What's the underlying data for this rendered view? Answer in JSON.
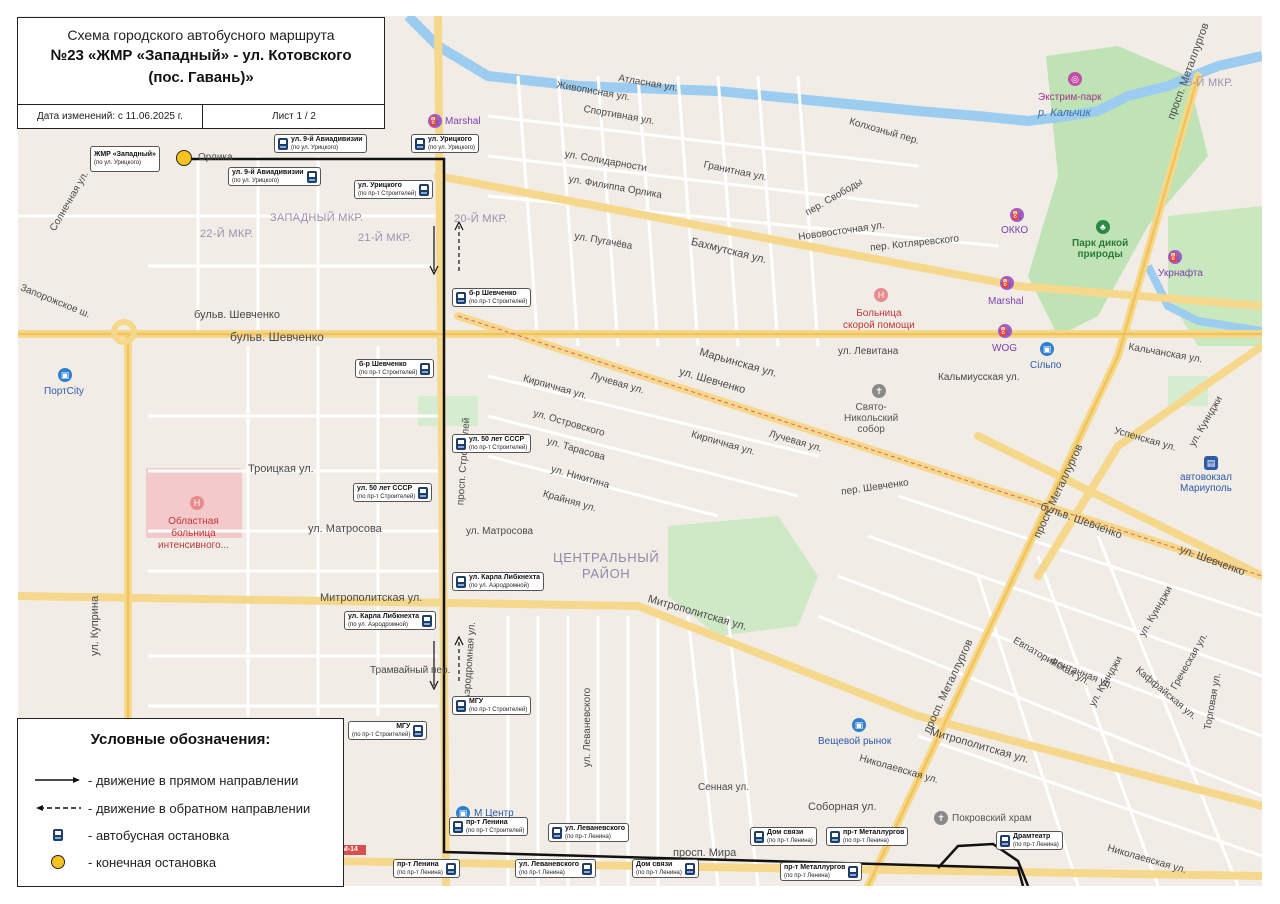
{
  "title": {
    "line1": "Схема городского автобусного маршрута",
    "line2": "№23 «ЖМР «Западный» - ул. Котовского",
    "line3": "(пос. Гавань)»",
    "date": "Дата изменений: с 11.06.2025 г.",
    "sheet": "Лист 1 / 2"
  },
  "legend": {
    "heading": "Условные обозначения:",
    "forward": "- движение в прямом направлении",
    "reverse": "- движение в обратном направлении",
    "bus_stop": "- автобусная остановка",
    "terminal": "- конечная остановка"
  },
  "terminal_stop": {
    "name": "ЖМР «Западный»",
    "sub": "(по ул. Урицкого)"
  },
  "stops": [
    {
      "name": "ул. 9-й Авиадивизии",
      "sub": "(по ул. Урицкого)"
    },
    {
      "name": "ул. Урицкого",
      "sub": "(по ул. Урицкого)"
    },
    {
      "name": "ул. 9-й Авиадивизии",
      "sub": "(по ул. Урицкого)"
    },
    {
      "name": "ул. Урицкого",
      "sub": "(по пр-т Строителей)"
    },
    {
      "name": "б-р Шевченко",
      "sub": "(по пр-т Строителей)"
    },
    {
      "name": "б-р Шевченко",
      "sub": "(по пр-т Строителей)"
    },
    {
      "name": "ул. 50 лет СССР",
      "sub": "(по пр-т Строителей)"
    },
    {
      "name": "ул. 50 лет СССР",
      "sub": "(по пр-т Строителей)"
    },
    {
      "name": "ул. Карла Либкнехта",
      "sub": "(по ул. Аэродромной)"
    },
    {
      "name": "ул. Карла Либкнехта",
      "sub": "(по ул. Аэродромной)"
    },
    {
      "name": "МГУ",
      "sub": "(по пр-т Строителей)"
    },
    {
      "name": "МГУ",
      "sub": "(по пр-т Строителей)"
    },
    {
      "name": "пр-т Ленина",
      "sub": "(по пр-т Строителей)"
    },
    {
      "name": "ул. Леваневского",
      "sub": "(по пр-т Ленина)"
    },
    {
      "name": "пр-т Ленина",
      "sub": "(по пр-т Ленина)"
    },
    {
      "name": "ул. Леваневского",
      "sub": "(по пр-т Ленина)"
    },
    {
      "name": "Дом связи",
      "sub": "(по пр-т Ленина)"
    },
    {
      "name": "Дом связи",
      "sub": "(по пр-т Ленина)"
    },
    {
      "name": "пр-т Металлургов",
      "sub": "(по пр-т Ленина)"
    },
    {
      "name": "пр-т Металлургов",
      "sub": "(по пр-т Ленина)"
    },
    {
      "name": "Драмтеатр",
      "sub": "(по пр-т Ленина)"
    }
  ],
  "districts": {
    "zapadny": "ЗАПАДНЫЙ МКР.",
    "mkr22": "22-Й МКР.",
    "mkr21": "21-Й МКР.",
    "mkr20": "20-Й МКР.",
    "mkr5": "5-Й МКР.",
    "central1": "ЦЕНТРАЛЬНЫЙ",
    "central2": "РАЙОН"
  },
  "streets": {
    "shevchenko_blvd": "бульв. Шевченко",
    "shevchenko_blvd2": "бульв. Шевченко",
    "shevchenko_blvd3": "бульв. Шевченко",
    "shevchenko_st": "ул. Шевченко",
    "shevchenko_st2": "ул. Шевченко",
    "kuprina": "ул. Куприна",
    "troitskaya": "Троицкая ул.",
    "matrosova": "ул. Матросова",
    "matrosova2": "ул. Матросова",
    "mitropolitskaya": "Митрополитская ул.",
    "mitropolitskaya2": "Митрополитская ул.",
    "mitropolitskaya3": "Митрополитская ул.",
    "tramvayny": "Трамвайный пер.",
    "marinskaya": "Марьинская ул.",
    "bakhmutskaya": "Бахмутская ул.",
    "metallurgov": "просп. Металлургов",
    "metallurgov2": "просп. Металлургов",
    "metallurgov3": "просп. Металлургов",
    "mira": "просп. Мира",
    "sobornaya": "Соборная ул.",
    "uspenskaya": "Успенская ул.",
    "nikolaevskaya": "Николаевская ул.",
    "nikolaevskaya2": "Николаевская ул.",
    "kalmiusskaya": "Кальмиусская ул.",
    "levitana": "ул. Левитана",
    "kotlyarevskogo": "пер. Котляревского",
    "svobody": "пер. Свободы",
    "novovostochnaya": "Нововосточная ул.",
    "kolkhozny": "Колхозный пер.",
    "atlasnaya": "Атласная ул.",
    "zhivopisnaya": "Живописная ул.",
    "sportivnaya": "Спортивная ул.",
    "solidarnosti": "ул. Солидарности",
    "orlika": "ул. Филиппа Орлика",
    "pugacheva": "ул. Пугачёва",
    "granitnaya": "Гранитная ул.",
    "luchevaya": "Лучевая ул.",
    "luchevaya2": "Лучевая ул.",
    "kirpichnaya": "Кирпичная ул.",
    "kirpichnaya2": "Кирпичная ул.",
    "ostrovskogo": "ул. Островского",
    "tarasova": "ул. Тарасова",
    "nikitina": "ул. Никитина",
    "krainyaya": "Крайняя ул.",
    "v_shevchenko": "пер. Шевченко",
    "gotfeiskaya": "Готфейская ул.",
    "evpatoriyskaya": "Евпаторийская ул.",
    "fontannaya": "Фонтанная ул.",
    "kaffaiskaya": "Каффайская ул.",
    "grecheskaya": "Греческая ул.",
    "torgovaya": "Торговая ул.",
    "kuindzhi": "ул. Куинджи",
    "kuindzhi2": "ул. Куинджи",
    "kuindzhi3": "ул. Куинджи",
    "kalchanskaya": "Кальчанская ул.",
    "levanevskogo": "ул. Леваневского",
    "senyaya": "Сенная ул.",
    "orlika_top": "Орлика",
    "solnechnaya": "Солнечная ул.",
    "zaporozhskoe": "Запорожское ш.",
    "stroiteley": "просп. Строителей",
    "aerodromnaya": "Аэродромная ул."
  },
  "pois": {
    "portcity": "ПортCity",
    "marshal": "Marshal",
    "marshal2": "Marshal",
    "okko": "ОККО",
    "ukrnafta": "Укрнафта",
    "wog": "WOG",
    "silpo": "Сільпо",
    "hospital1": "Больница",
    "hospital2": "скорой помощи",
    "oblast1": "Областная",
    "oblast2": "больница",
    "oblast3": "интенсивного...",
    "church1": "Свято-",
    "church2": "Никольский",
    "church3": "собор",
    "pokrov": "Покровский храм",
    "market": "Вещевой рынок",
    "station1": "автовокзал",
    "station2": "Мариуполь",
    "extreme": "Экстрим-парк",
    "river": "р. Кальчик",
    "park1": "Парк дикой",
    "park2": "природы",
    "mcenter": "М Центр",
    "road_m14": "М-14"
  },
  "colors": {
    "route": "#111111",
    "terminal": "#f7c21b",
    "bus_stop": "#1f3d6b",
    "major_road": "#f6d88c",
    "water": "#9ccdf0",
    "park": "#bfe3b4",
    "hospital": "#e98a8d"
  }
}
